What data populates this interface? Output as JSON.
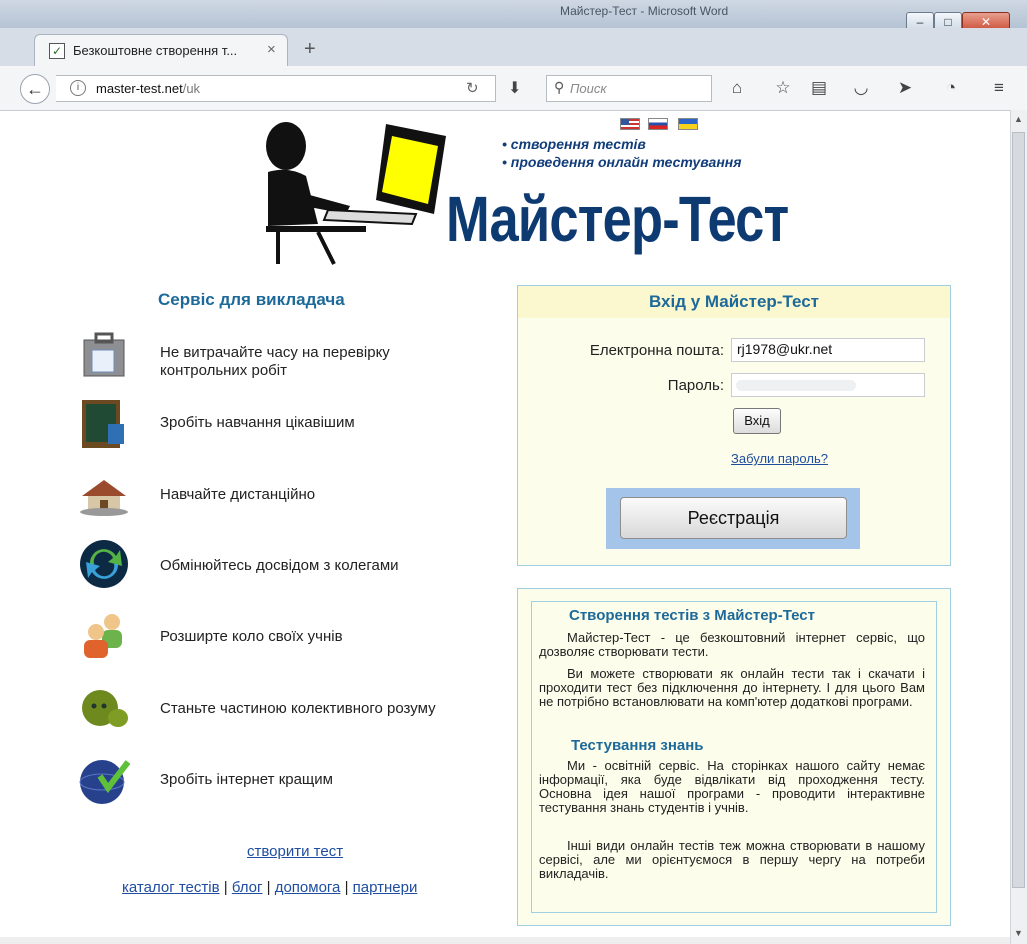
{
  "window": {
    "title": "Майстер-Тест - Microsoft Word"
  },
  "browser": {
    "tab_title": "Безкоштовне створення т...",
    "url_host": "master-test.net",
    "url_path": "/uk",
    "search_placeholder": "Поиск"
  },
  "header": {
    "bullets": [
      "• створення тестів",
      "• проведення онлайн тестування"
    ],
    "logo_text": "Майстер-Тест",
    "flags": [
      "us-flag",
      "ru-flag",
      "ua-flag"
    ]
  },
  "left": {
    "title": "Сервіс для викладача",
    "features": [
      {
        "label": "Не витрачайте часу на перевірку контрольних робіт",
        "icon": "briefcase-icon"
      },
      {
        "label": "Зробіть навчання цікавішим",
        "icon": "chalkboard-icon"
      },
      {
        "label": "Навчайте дистанційно",
        "icon": "house-icon"
      },
      {
        "label": "Обмінюйтесь досвідом з колегами",
        "icon": "exchange-icon"
      },
      {
        "label": "Розширте коло своїх учнів",
        "icon": "users-icon"
      },
      {
        "label": "Станьте частиною колективного розуму",
        "icon": "blob-icon"
      },
      {
        "label": "Зробіть інтернет кращим",
        "icon": "globe-check-icon"
      }
    ],
    "create_link": "створити тест",
    "footer_links": [
      "каталог тестів",
      "блог",
      "допомога",
      "партнери"
    ]
  },
  "login": {
    "title": "Вхід у Майстер-Тест",
    "email_label": "Електронна пошта:",
    "email_value": "rj1978@ukr.net",
    "password_label": "Пароль:",
    "enter_button": "Вхід",
    "forgot_link": "Забули пароль?",
    "register_button": "Реєстрація"
  },
  "info": {
    "heading1": "Створення тестів з Майстер-Тест",
    "p1": "Майстер-Тест - це безкоштовний інтернет сервіс, що дозволяє створювати тести.",
    "p2": "Ви можете створювати як онлайн тести так і скачати і проходити тест без підключення до інтернету. І для цього Вам не потрібно встановлювати на комп'ютер додаткові програми.",
    "heading2": "Тестування знань",
    "p3": "Ми - освітній сервіс. На сторінках нашого сайту немає інформації, яка буде відвлікати від проходження тесту. Основна ідея нашої програми - проводити інтерактивне тестування знань студентів і учнів.",
    "p4": "Інші види онлайн тестів теж можна створювати в нашому сервісі, але ми орієнтуємося в першу чергу на потреби викладачів."
  }
}
